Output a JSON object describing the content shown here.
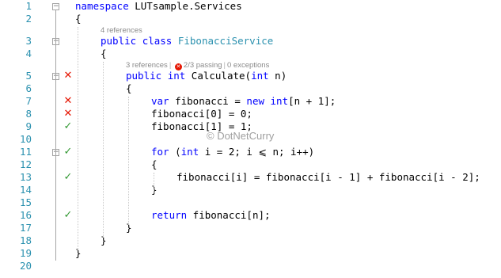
{
  "editor": {
    "lines": [
      {
        "n": "1",
        "parts": [
          [
            "kw",
            "namespace"
          ],
          [
            "",
            ""
          ],
          [
            "tx",
            " LUTsample.Services"
          ]
        ]
      },
      {
        "n": "2",
        "parts": [
          [
            "tx",
            "{"
          ]
        ]
      },
      {
        "n": "3",
        "parts": [
          [
            "kw",
            "public"
          ],
          [
            "tx",
            " "
          ],
          [
            "kw",
            "class"
          ],
          [
            "tx",
            " "
          ],
          [
            "ty",
            "FibonacciService"
          ]
        ]
      },
      {
        "n": "4",
        "parts": [
          [
            "tx",
            "{"
          ]
        ]
      },
      {
        "n": "5",
        "parts": [
          [
            "kw",
            "public"
          ],
          [
            "tx",
            " "
          ],
          [
            "kw",
            "int"
          ],
          [
            "tx",
            " Calculate("
          ],
          [
            "kw",
            "int"
          ],
          [
            "tx",
            " n)"
          ]
        ]
      },
      {
        "n": "6",
        "parts": [
          [
            "tx",
            "{"
          ]
        ]
      },
      {
        "n": "7",
        "parts": [
          [
            "kw",
            "var"
          ],
          [
            "tx",
            " fibonacci = "
          ],
          [
            "kw",
            "new"
          ],
          [
            "tx",
            " "
          ],
          [
            "kw",
            "int"
          ],
          [
            "tx",
            "[n + 1];"
          ]
        ]
      },
      {
        "n": "8",
        "parts": [
          [
            "tx",
            "fibonacci[0] = 0;"
          ]
        ]
      },
      {
        "n": "9",
        "parts": [
          [
            "tx",
            "fibonacci[1] = 1;"
          ]
        ]
      },
      {
        "n": "10",
        "parts": []
      },
      {
        "n": "11",
        "parts": [
          [
            "kw",
            "for"
          ],
          [
            "tx",
            " ("
          ],
          [
            "kw",
            "int"
          ],
          [
            "tx",
            " i = 2; i ⩽ n; i++)"
          ]
        ]
      },
      {
        "n": "12",
        "parts": [
          [
            "tx",
            "{"
          ]
        ]
      },
      {
        "n": "13",
        "parts": [
          [
            "tx",
            "fibonacci[i] = fibonacci[i - 1] + fibonacci[i - 2];"
          ]
        ]
      },
      {
        "n": "14",
        "parts": [
          [
            "tx",
            "}"
          ]
        ]
      },
      {
        "n": "15",
        "parts": []
      },
      {
        "n": "16",
        "parts": [
          [
            "kw",
            "return"
          ],
          [
            "tx",
            " fibonacci[n];"
          ]
        ]
      },
      {
        "n": "17",
        "parts": [
          [
            "tx",
            "}"
          ]
        ]
      },
      {
        "n": "18",
        "parts": [
          [
            "tx",
            "}"
          ]
        ]
      },
      {
        "n": "19",
        "parts": [
          [
            "tx",
            "}"
          ]
        ]
      },
      {
        "n": "20",
        "parts": []
      }
    ],
    "codelens": {
      "class_refs": "4 references",
      "method_refs": "3 references",
      "method_tests": "2/3 passing",
      "method_exceptions": "0 exceptions",
      "separator": "|"
    },
    "test_status": {
      "5": "fail",
      "7": "fail",
      "8": "fail",
      "9": "pass",
      "11": "pass",
      "13": "pass",
      "16": "pass"
    },
    "status_glyphs": {
      "fail": "✕",
      "pass": "✓"
    },
    "colors": {
      "keyword": "#0000ff",
      "type": "#2b91af",
      "line_number": "#2b91af",
      "fail": "#e51400",
      "pass": "#339933"
    },
    "watermark": "© DotNetCurry"
  }
}
